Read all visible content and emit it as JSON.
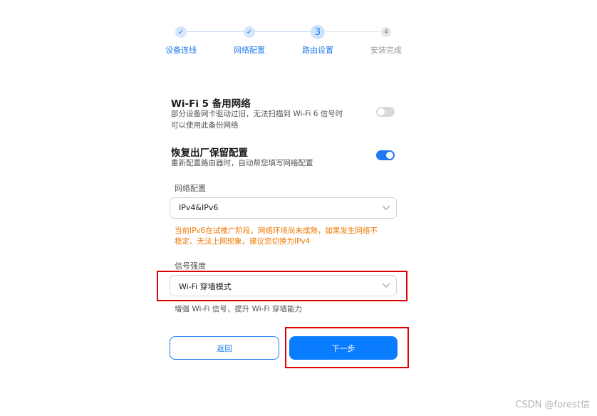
{
  "stepper": {
    "steps": [
      {
        "label": "设备连线",
        "status": "done",
        "marker": "✓"
      },
      {
        "label": "网络配置",
        "status": "done",
        "marker": "✓"
      },
      {
        "label": "路由设置",
        "status": "current",
        "marker": "3"
      },
      {
        "label": "安装完成",
        "status": "todo",
        "marker": "4"
      }
    ]
  },
  "wifi5_backup": {
    "title": "Wi-Fi 5 备用网络",
    "desc_line1": "部分设备网卡驱动过旧，无法扫描到 Wi-Fi 6 信号时",
    "desc_line2": "可以使用此备份网络",
    "enabled": false
  },
  "factory_restore": {
    "title": "恢复出厂保留配置",
    "desc": "重新配置路由器时，自动帮您填写网络配置",
    "enabled": true
  },
  "network_config": {
    "label": "网络配置",
    "value": "IPv4&IPv6",
    "warning_line1": "当前IPv6在试推广阶段，网络环境尚未成熟，如果发生网络不",
    "warning_line2": "稳定、无法上网现象，建议您切换为IPv4"
  },
  "signal_strength": {
    "label": "信号强度",
    "value": "Wi-Fi 穿墙模式",
    "hint": "增强 Wi-Fi 信号，提升 Wi-Fi 穿墙能力"
  },
  "buttons": {
    "back": "返回",
    "next": "下一步"
  },
  "watermark": "CSDN @forest信",
  "colors": {
    "accent": "#1f7bf0",
    "warning": "#f07800",
    "highlight": "#e00000"
  }
}
